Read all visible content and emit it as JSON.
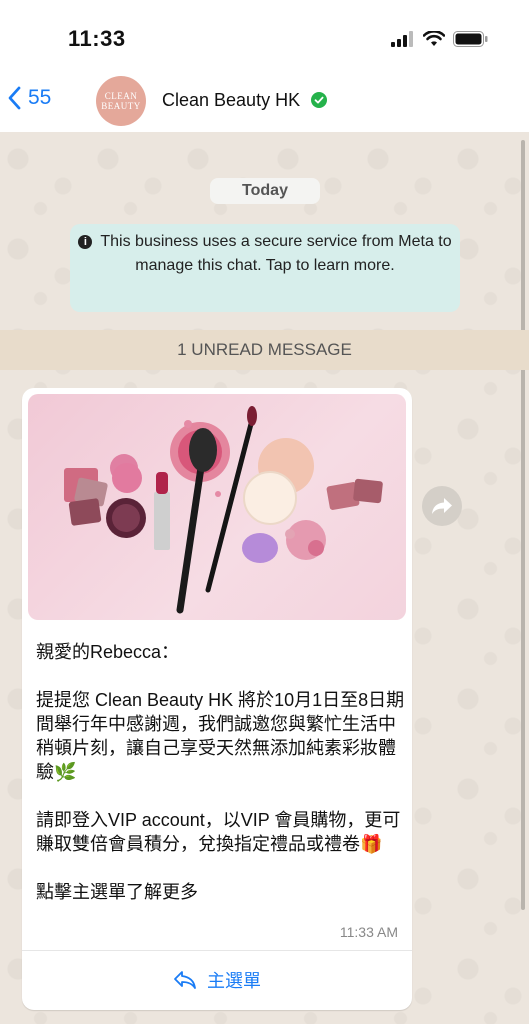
{
  "status": {
    "time": "11:33"
  },
  "header": {
    "back_count": "55",
    "avatar_line1": "CLEAN",
    "avatar_line2": "BEAUTY",
    "chat_name": "Clean Beauty HK"
  },
  "chat": {
    "date_label": "Today",
    "secure_notice": "This business uses a secure service from Meta to manage this chat. Tap to learn more.",
    "unread_label": "1 UNREAD MESSAGE",
    "message": {
      "text": "親愛的Rebecca：\n\n提提您 Clean Beauty HK 將於10月1日至8日期間舉行年中感謝週，我們誠邀您與繁忙生活中稍頓片刻，讓自己享受天然無添加純素彩妝體驗🌿\n\n請即登入VIP account，以VIP 會員購物，更可賺取雙倍會員積分，兌換指定禮品或禮卷🎁\n\n點擊主選單了解更多",
      "time": "11:33 AM",
      "menu_label": "主選單"
    }
  },
  "icons": {
    "back": "chevron-left-icon",
    "verified": "verified-badge-icon",
    "info": "info-icon",
    "reply": "reply-icon",
    "forward": "forward-icon"
  },
  "colors": {
    "accent": "#1a7cf5",
    "verified": "#25b24b",
    "notice_bg": "#d7eeeb",
    "unread_bg": "#e8dccb"
  }
}
